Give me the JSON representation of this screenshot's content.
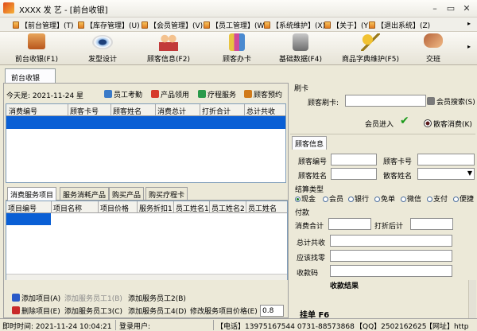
{
  "window": {
    "title": "XXXX 发 艺 - [前台收银]"
  },
  "menu": [
    {
      "label": "【前台管理】(T)"
    },
    {
      "label": "【库存管理】(U)"
    },
    {
      "label": "【会员管理】(V)"
    },
    {
      "label": "【员工管理】(W)"
    },
    {
      "label": "【系统维护】(X)"
    },
    {
      "label": "【关于】(Y)"
    },
    {
      "label": "【退出系统】(Z)"
    }
  ],
  "toolbar": [
    {
      "label": "前台收银(F1)",
      "icon": "cash-register-icon"
    },
    {
      "label": "发型设计",
      "icon": "eye-icon"
    },
    {
      "label": "顾客信息(F2)",
      "icon": "customers-icon"
    },
    {
      "label": "顾客办卡",
      "icon": "card-icon"
    },
    {
      "label": "基础数据(F4)",
      "icon": "database-icon"
    },
    {
      "label": "商品字典维护(F5)",
      "icon": "keys-icon"
    },
    {
      "label": "交班",
      "icon": "handshake-icon"
    }
  ],
  "page_tab": "前台收银",
  "left": {
    "date_label": "今天是: 2021-11-24  星",
    "buttons": [
      "员工考勤",
      "产品领用",
      "疗程服务",
      "顾客预约"
    ],
    "main_grid_headers": [
      "消费编号",
      "顾客卡号",
      "顾客姓名",
      "消费总计",
      "打折合计",
      "总计共收"
    ],
    "subtabs": [
      "消费服务项目",
      "服务消耗产品",
      "购买产品",
      "购买疗程卡"
    ],
    "item_grid_headers": [
      "项目编号",
      "项目名称",
      "项目价格",
      "服务折扣1",
      "员工姓名1",
      "员工姓名2",
      "员工姓名"
    ],
    "actions": {
      "add_item": "添加项目(A)",
      "add_staff1": "添加服务员工1(B)",
      "add_staff2": "添加服务员工2(B)",
      "delete_item": "删除项目(E)",
      "add_staff3": "添加服务员工3(C)",
      "add_staff4": "添加服务员工4(D)",
      "modify_price": "修改服务项目价格(E)",
      "price_value": "0.8"
    }
  },
  "right": {
    "card_group": "刷卡",
    "card_label": "顾客刷卡:",
    "member_search": "会员搜索(S)",
    "member_enter": "会员进入",
    "walkin": "散客消费(K)",
    "cust_tab": "顾客信息",
    "cust_id": "顾客编号",
    "cust_card": "顾客卡号",
    "cust_name": "顾客姓名",
    "cust_type": "散客姓名",
    "pay_group": "结算类型",
    "pay_types": [
      "现金",
      "会员",
      "银行",
      "免单",
      "微信",
      "支付",
      "便捷"
    ],
    "pay_section": "付款",
    "total": "消费合计",
    "discount_total": "打折后计",
    "grand_total": "总计共收",
    "change": "应该找零",
    "code": "收款码",
    "settle": "收款结果",
    "hang": "挂单  F6"
  },
  "status": {
    "time": "即时时间:  2021-11-24 10:04:21",
    "login": "登录用户:",
    "phone": "【电话】13975167544  0731-88573868",
    "qq": "【QQ】2502162625",
    "web": "【网址】http"
  }
}
